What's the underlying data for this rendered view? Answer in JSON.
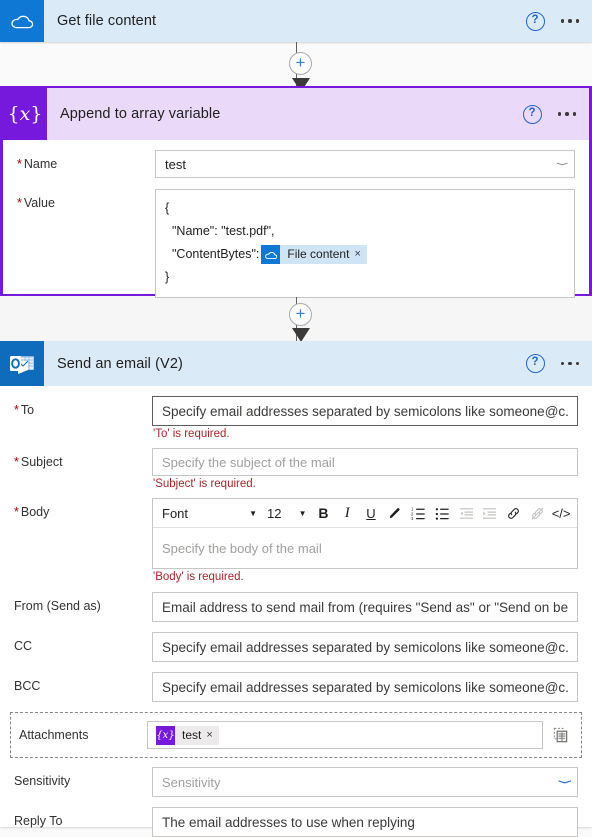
{
  "colors": {
    "onedrive_tile": "#0f78d4",
    "variable_tile": "#7719dd",
    "outlook_tile": "#0f6cbd",
    "header_blue": "#daeaf7",
    "header_purple": "#ead9f9",
    "selected_border": "#7719dd",
    "required_asterisk": "#a80000",
    "error_text": "#a4262c",
    "accent_blue": "#2266cc"
  },
  "cards": {
    "get_file_content": {
      "title": "Get file content",
      "icon": "onedrive-icon",
      "help_icon": "help-icon",
      "more_icon": "more-options-icon"
    },
    "append_to_array": {
      "title": "Append to array variable",
      "icon": "variable-braces-icon",
      "help_icon": "help-icon",
      "more_icon": "more-options-icon",
      "selected": true,
      "name_field": {
        "label": "Name",
        "required": true,
        "value": "test",
        "chevron": "chevron-down-icon"
      },
      "value_field": {
        "label": "Value",
        "required": true,
        "lines": [
          {
            "text": "{",
            "indent": 0
          },
          {
            "text": "\"Name\": \"test.pdf\",",
            "indent": 1
          },
          {
            "text": "\"ContentBytes\":",
            "indent": 1,
            "token": {
              "label": "File content",
              "icon": "onedrive-icon",
              "remove": "×"
            }
          },
          {
            "text": "}",
            "indent": 0
          }
        ]
      }
    },
    "send_an_email": {
      "title": "Send an email (V2)",
      "icon": "outlook-icon",
      "help_icon": "help-icon",
      "more_icon": "more-options-icon",
      "fields": {
        "to": {
          "label": "To",
          "required": true,
          "placeholder": "Specify email addresses separated by semicolons like someone@c...",
          "error": "'To' is required.",
          "focused": true
        },
        "subject": {
          "label": "Subject",
          "required": true,
          "placeholder": "Specify the subject of the mail",
          "error": "'Subject' is required."
        },
        "body": {
          "label": "Body",
          "required": true,
          "placeholder": "Specify the body of the mail",
          "error": "'Body' is required.",
          "toolbar": {
            "font_label": "Font",
            "font_caret": "chevron-down-icon",
            "size_label": "12",
            "size_caret": "chevron-down-icon",
            "buttons": [
              {
                "name": "bold-icon",
                "glyph": "B",
                "style": "bold",
                "disabled": false
              },
              {
                "name": "italic-icon",
                "glyph": "I",
                "style": "ital",
                "disabled": false
              },
              {
                "name": "underline-icon",
                "glyph": "U",
                "style": "undl",
                "disabled": false
              },
              {
                "name": "text-highlight-icon",
                "glyph": "✐",
                "style": "",
                "disabled": false
              },
              {
                "name": "numbered-list-icon",
                "glyph": "≣",
                "style": "",
                "disabled": false
              },
              {
                "name": "bulleted-list-icon",
                "glyph": "☰",
                "style": "",
                "disabled": false
              },
              {
                "name": "decrease-indent-icon",
                "glyph": "≡",
                "style": "",
                "disabled": true
              },
              {
                "name": "increase-indent-icon",
                "glyph": "≡",
                "style": "",
                "disabled": true
              },
              {
                "name": "insert-link-icon",
                "glyph": "🔗",
                "style": "",
                "disabled": false
              },
              {
                "name": "remove-link-icon",
                "glyph": "🔗",
                "style": "",
                "disabled": true
              },
              {
                "name": "code-view-icon",
                "glyph": "</>",
                "style": "",
                "disabled": false
              }
            ]
          }
        },
        "from": {
          "label": "From (Send as)",
          "required": false,
          "placeholder": "Email address to send mail from (requires \"Send as\" or \"Send on be..."
        },
        "cc": {
          "label": "CC",
          "required": false,
          "placeholder": "Specify email addresses separated by semicolons like someone@c..."
        },
        "bcc": {
          "label": "BCC",
          "required": false,
          "placeholder": "Specify email addresses separated by semicolons like someone@c..."
        },
        "attachments": {
          "label": "Attachments",
          "required": false,
          "token": {
            "label": "test",
            "icon": "variable-braces-icon",
            "remove": "×"
          },
          "switch_icon": "switch-to-array-input-icon"
        },
        "sensitivity": {
          "label": "Sensitivity",
          "required": false,
          "placeholder": "Sensitivity",
          "chevron": "chevron-down-icon"
        },
        "reply_to": {
          "label": "Reply To",
          "required": false,
          "placeholder": "The email addresses to use when replying"
        }
      }
    }
  },
  "connectors": {
    "add_step_label": "+",
    "add_icon": "add-step-plus-icon",
    "arrow_icon": "flow-arrow-down-icon"
  }
}
